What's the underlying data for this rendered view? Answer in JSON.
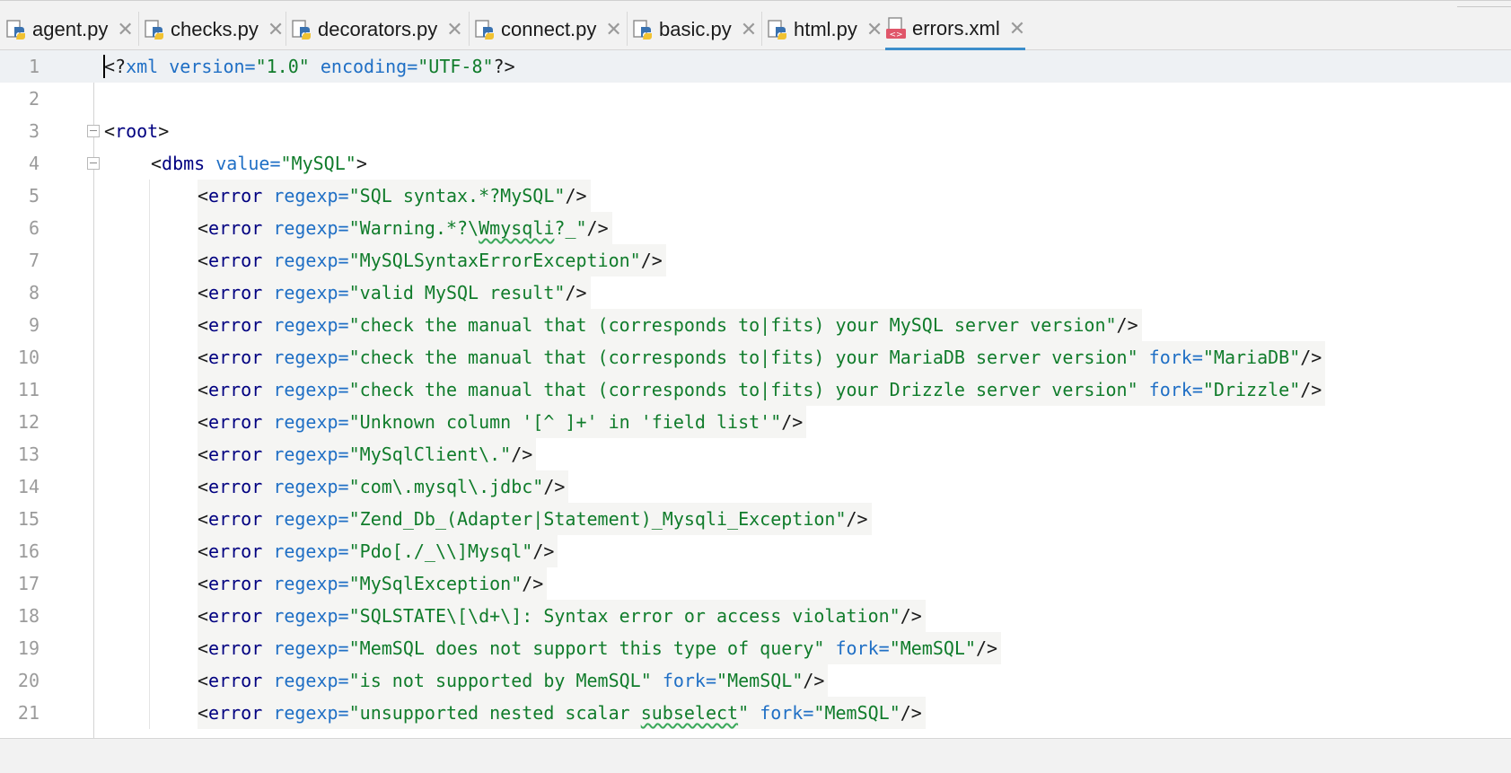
{
  "tabs": [
    {
      "label": "agent.py",
      "icon": "python-file-icon",
      "active": false
    },
    {
      "label": "checks.py",
      "icon": "python-file-icon",
      "active": false
    },
    {
      "label": "decorators.py",
      "icon": "python-file-icon",
      "active": false
    },
    {
      "label": "connect.py",
      "icon": "python-file-icon",
      "active": false
    },
    {
      "label": "basic.py",
      "icon": "python-file-icon",
      "active": false
    },
    {
      "label": "html.py",
      "icon": "python-file-icon",
      "active": false
    },
    {
      "label": "errors.xml",
      "icon": "xml-file-icon",
      "active": true
    }
  ],
  "colors": {
    "accent": "#3d8ecb",
    "tag": "#000080",
    "attribute": "#1f6fc5",
    "string": "#107c2b",
    "line_number": "#9b9b9b"
  },
  "editor": {
    "lines": [
      {
        "n": "1",
        "indent": 0,
        "tokens": [
          [
            "t-punct",
            "<?"
          ],
          [
            "t-decl",
            "xml version="
          ],
          [
            "t-str",
            "\"1.0\""
          ],
          [
            "t-punct",
            " "
          ],
          [
            "t-decl",
            "encoding="
          ],
          [
            "t-str",
            "\"UTF-8\""
          ],
          [
            "t-punct",
            "?>"
          ]
        ]
      },
      {
        "n": "2",
        "indent": 0,
        "tokens": []
      },
      {
        "n": "3",
        "indent": 0,
        "tokens": [
          [
            "t-punct",
            "<"
          ],
          [
            "t-tag",
            "root"
          ],
          [
            "t-punct",
            ">"
          ]
        ]
      },
      {
        "n": "4",
        "indent": 1,
        "tokens": [
          [
            "t-punct",
            "<"
          ],
          [
            "t-tag",
            "dbms"
          ],
          [
            "t-punct",
            " "
          ],
          [
            "t-attr",
            "value="
          ],
          [
            "t-str",
            "\"MySQL\""
          ],
          [
            "t-punct",
            ">"
          ]
        ]
      },
      {
        "n": "5",
        "indent": 2,
        "tokens": [
          [
            "t-punct",
            "<"
          ],
          [
            "t-tag",
            "error"
          ],
          [
            "t-punct",
            " "
          ],
          [
            "t-attr",
            "regexp="
          ],
          [
            "t-str",
            "\"SQL syntax.*?MySQL\""
          ],
          [
            "t-punct",
            "/>"
          ]
        ]
      },
      {
        "n": "6",
        "indent": 2,
        "tokens": [
          [
            "t-punct",
            "<"
          ],
          [
            "t-tag",
            "error"
          ],
          [
            "t-punct",
            " "
          ],
          [
            "t-attr",
            "regexp="
          ],
          [
            "t-str",
            "\"Warning.*?\\"
          ],
          [
            "t-str squiggle",
            "Wmysqli"
          ],
          [
            "t-str",
            "?_\""
          ],
          [
            "t-punct",
            "/>"
          ]
        ]
      },
      {
        "n": "7",
        "indent": 2,
        "tokens": [
          [
            "t-punct",
            "<"
          ],
          [
            "t-tag",
            "error"
          ],
          [
            "t-punct",
            " "
          ],
          [
            "t-attr",
            "regexp="
          ],
          [
            "t-str",
            "\"MySQLSyntaxErrorException\""
          ],
          [
            "t-punct",
            "/>"
          ]
        ]
      },
      {
        "n": "8",
        "indent": 2,
        "tokens": [
          [
            "t-punct",
            "<"
          ],
          [
            "t-tag",
            "error"
          ],
          [
            "t-punct",
            " "
          ],
          [
            "t-attr",
            "regexp="
          ],
          [
            "t-str",
            "\"valid MySQL result\""
          ],
          [
            "t-punct",
            "/>"
          ]
        ]
      },
      {
        "n": "9",
        "indent": 2,
        "tokens": [
          [
            "t-punct",
            "<"
          ],
          [
            "t-tag",
            "error"
          ],
          [
            "t-punct",
            " "
          ],
          [
            "t-attr",
            "regexp="
          ],
          [
            "t-str",
            "\"check the manual that (corresponds to|fits) your MySQL server version\""
          ],
          [
            "t-punct",
            "/>"
          ]
        ]
      },
      {
        "n": "10",
        "indent": 2,
        "tokens": [
          [
            "t-punct",
            "<"
          ],
          [
            "t-tag",
            "error"
          ],
          [
            "t-punct",
            " "
          ],
          [
            "t-attr",
            "regexp="
          ],
          [
            "t-str",
            "\"check the manual that (corresponds to|fits) your MariaDB server version\""
          ],
          [
            "t-punct",
            " "
          ],
          [
            "t-attr",
            "fork="
          ],
          [
            "t-str",
            "\"MariaDB\""
          ],
          [
            "t-punct",
            "/>"
          ]
        ]
      },
      {
        "n": "11",
        "indent": 2,
        "tokens": [
          [
            "t-punct",
            "<"
          ],
          [
            "t-tag",
            "error"
          ],
          [
            "t-punct",
            " "
          ],
          [
            "t-attr",
            "regexp="
          ],
          [
            "t-str",
            "\"check the manual that (corresponds to|fits) your Drizzle server version\""
          ],
          [
            "t-punct",
            " "
          ],
          [
            "t-attr",
            "fork="
          ],
          [
            "t-str",
            "\"Drizzle\""
          ],
          [
            "t-punct",
            "/>"
          ]
        ]
      },
      {
        "n": "12",
        "indent": 2,
        "tokens": [
          [
            "t-punct",
            "<"
          ],
          [
            "t-tag",
            "error"
          ],
          [
            "t-punct",
            " "
          ],
          [
            "t-attr",
            "regexp="
          ],
          [
            "t-str",
            "\"Unknown column '[^ ]+' in 'field list'\""
          ],
          [
            "t-punct",
            "/>"
          ]
        ]
      },
      {
        "n": "13",
        "indent": 2,
        "tokens": [
          [
            "t-punct",
            "<"
          ],
          [
            "t-tag",
            "error"
          ],
          [
            "t-punct",
            " "
          ],
          [
            "t-attr",
            "regexp="
          ],
          [
            "t-str",
            "\"MySqlClient\\.\""
          ],
          [
            "t-punct",
            "/>"
          ]
        ]
      },
      {
        "n": "14",
        "indent": 2,
        "tokens": [
          [
            "t-punct",
            "<"
          ],
          [
            "t-tag",
            "error"
          ],
          [
            "t-punct",
            " "
          ],
          [
            "t-attr",
            "regexp="
          ],
          [
            "t-str",
            "\"com\\.mysql\\.jdbc\""
          ],
          [
            "t-punct",
            "/>"
          ]
        ]
      },
      {
        "n": "15",
        "indent": 2,
        "tokens": [
          [
            "t-punct",
            "<"
          ],
          [
            "t-tag",
            "error"
          ],
          [
            "t-punct",
            " "
          ],
          [
            "t-attr",
            "regexp="
          ],
          [
            "t-str",
            "\"Zend_Db_(Adapter|Statement)_Mysqli_Exception\""
          ],
          [
            "t-punct",
            "/>"
          ]
        ]
      },
      {
        "n": "16",
        "indent": 2,
        "tokens": [
          [
            "t-punct",
            "<"
          ],
          [
            "t-tag",
            "error"
          ],
          [
            "t-punct",
            " "
          ],
          [
            "t-attr",
            "regexp="
          ],
          [
            "t-str",
            "\"Pdo[./_\\\\]Mysql\""
          ],
          [
            "t-punct",
            "/>"
          ]
        ]
      },
      {
        "n": "17",
        "indent": 2,
        "tokens": [
          [
            "t-punct",
            "<"
          ],
          [
            "t-tag",
            "error"
          ],
          [
            "t-punct",
            " "
          ],
          [
            "t-attr",
            "regexp="
          ],
          [
            "t-str",
            "\"MySqlException\""
          ],
          [
            "t-punct",
            "/>"
          ]
        ]
      },
      {
        "n": "18",
        "indent": 2,
        "tokens": [
          [
            "t-punct",
            "<"
          ],
          [
            "t-tag",
            "error"
          ],
          [
            "t-punct",
            " "
          ],
          [
            "t-attr",
            "regexp="
          ],
          [
            "t-str",
            "\"SQLSTATE\\[\\d+\\]: Syntax error or access violation\""
          ],
          [
            "t-punct",
            "/>"
          ]
        ]
      },
      {
        "n": "19",
        "indent": 2,
        "tokens": [
          [
            "t-punct",
            "<"
          ],
          [
            "t-tag",
            "error"
          ],
          [
            "t-punct",
            " "
          ],
          [
            "t-attr",
            "regexp="
          ],
          [
            "t-str",
            "\"MemSQL does not support this type of query\""
          ],
          [
            "t-punct",
            " "
          ],
          [
            "t-attr",
            "fork="
          ],
          [
            "t-str",
            "\"MemSQL\""
          ],
          [
            "t-punct",
            "/>"
          ]
        ]
      },
      {
        "n": "20",
        "indent": 2,
        "tokens": [
          [
            "t-punct",
            "<"
          ],
          [
            "t-tag",
            "error"
          ],
          [
            "t-punct",
            " "
          ],
          [
            "t-attr",
            "regexp="
          ],
          [
            "t-str",
            "\"is not supported by MemSQL\""
          ],
          [
            "t-punct",
            " "
          ],
          [
            "t-attr",
            "fork="
          ],
          [
            "t-str",
            "\"MemSQL\""
          ],
          [
            "t-punct",
            "/>"
          ]
        ]
      },
      {
        "n": "21",
        "indent": 2,
        "tokens": [
          [
            "t-punct",
            "<"
          ],
          [
            "t-tag",
            "error"
          ],
          [
            "t-punct",
            " "
          ],
          [
            "t-attr",
            "regexp="
          ],
          [
            "t-str",
            "\"unsupported nested scalar "
          ],
          [
            "t-str squiggle",
            "subselect"
          ],
          [
            "t-str",
            "\""
          ],
          [
            "t-punct",
            " "
          ],
          [
            "t-attr",
            "fork="
          ],
          [
            "t-str",
            "\"MemSQL\""
          ],
          [
            "t-punct",
            "/>"
          ]
        ]
      }
    ]
  }
}
